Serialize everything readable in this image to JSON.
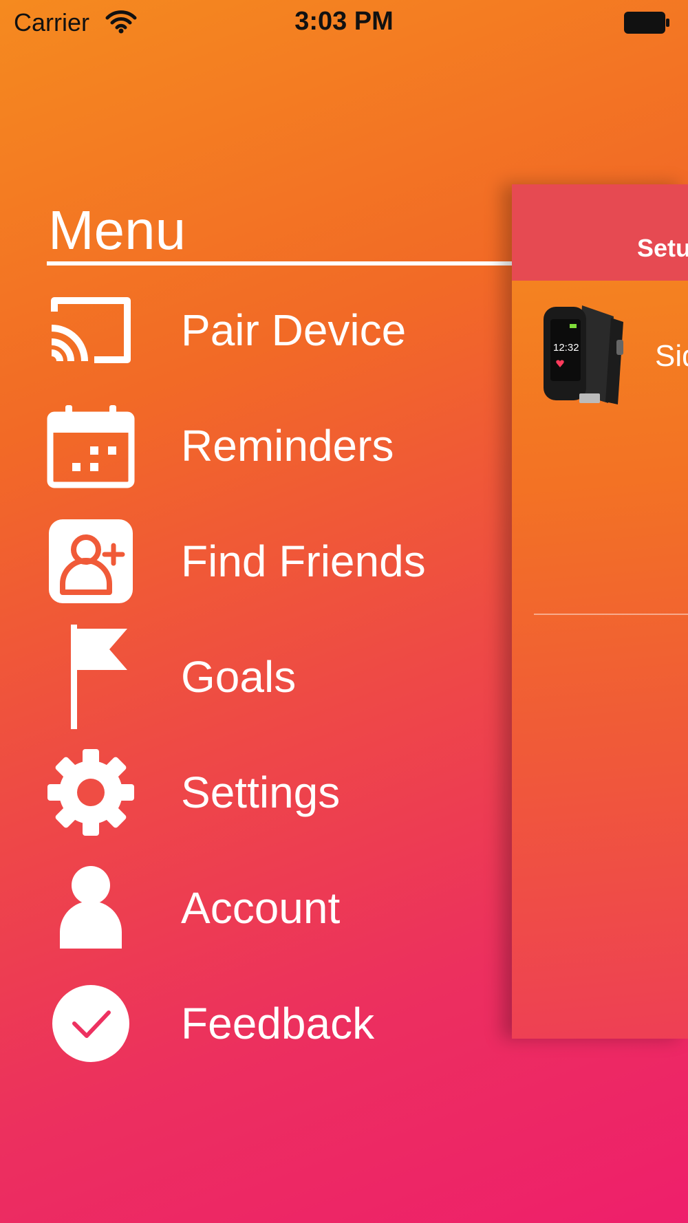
{
  "status_bar": {
    "carrier": "Carrier",
    "time": "3:03 PM"
  },
  "menu": {
    "title": "Menu",
    "items": [
      {
        "label": "Pair Device",
        "icon": "cast-icon"
      },
      {
        "label": "Reminders",
        "icon": "calendar-icon"
      },
      {
        "label": "Find Friends",
        "icon": "add-friend-icon"
      },
      {
        "label": "Goals",
        "icon": "flag-icon"
      },
      {
        "label": "Settings",
        "icon": "gear-icon"
      },
      {
        "label": "Account",
        "icon": "person-icon"
      },
      {
        "label": "Feedback",
        "icon": "check-circle-icon"
      }
    ]
  },
  "panel": {
    "title": "Setu",
    "device_name": "Sid",
    "watch_time": "12:32"
  },
  "colors": {
    "gradient_top": "#f58a1f",
    "gradient_bottom": "#ee1f6b",
    "panel_header": "#e64a52",
    "text": "#ffffff"
  }
}
